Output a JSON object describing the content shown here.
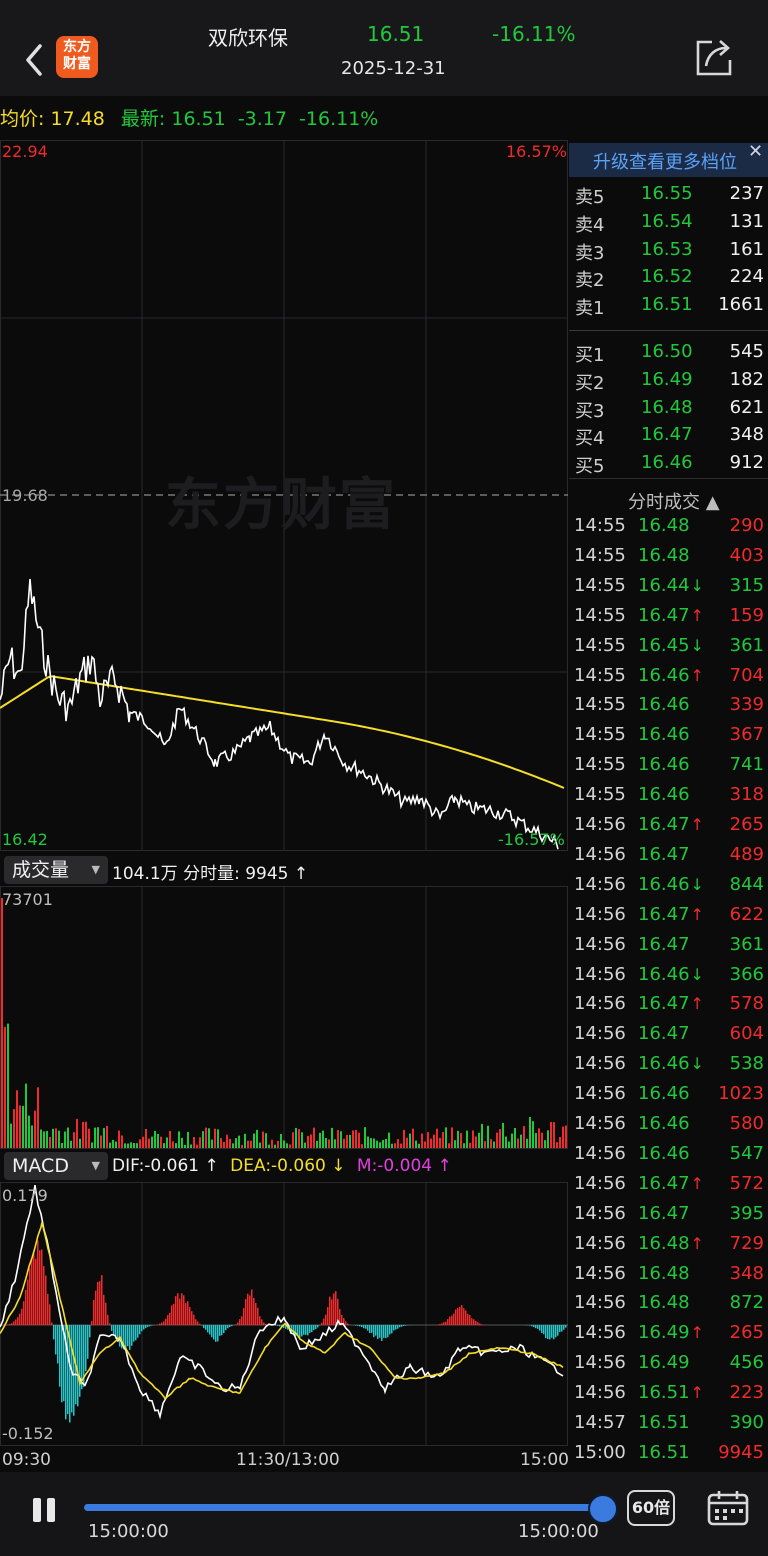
{
  "header": {
    "logo_line1": "东方",
    "logo_line2": "财富",
    "stock_name": "双欣环保",
    "price": "16.51",
    "pct": "-16.11%",
    "date": "2025-12-31"
  },
  "infobar": {
    "avg_label": "均价:",
    "avg_value": "17.48",
    "latest_label": "最新:",
    "latest_value": "16.51",
    "change": "-3.17",
    "pct": "-16.11%"
  },
  "price_chart": {
    "y_top": "22.94",
    "y_mid": "19.68",
    "y_bottom": "16.42",
    "pct_top": "16.57%",
    "pct_bottom": "-16.57%",
    "watermark": "东方财富"
  },
  "volume": {
    "selector": "成交量",
    "total": "104.1万",
    "tick_label": "分时量:",
    "tick_value": "9945",
    "tick_arrow": "↑",
    "max_label": "73701"
  },
  "macd": {
    "selector": "MACD",
    "dif": "DIF:-0.061 ↑",
    "dea": "DEA:-0.060 ↓",
    "m": "M:-0.004 ↑",
    "top": "0.179",
    "bottom": "-0.152"
  },
  "time_axis": {
    "start": "09:30",
    "mid": "11:30/13:00",
    "end": "15:00"
  },
  "orderbook": {
    "upgrade": "升级查看更多档位",
    "asks": [
      {
        "label": "卖5",
        "price": "16.55",
        "qty": "237"
      },
      {
        "label": "卖4",
        "price": "16.54",
        "qty": "131"
      },
      {
        "label": "卖3",
        "price": "16.53",
        "qty": "161"
      },
      {
        "label": "卖2",
        "price": "16.52",
        "qty": "224"
      },
      {
        "label": "卖1",
        "price": "16.51",
        "qty": "1661"
      }
    ],
    "bids": [
      {
        "label": "买1",
        "price": "16.50",
        "qty": "545"
      },
      {
        "label": "买2",
        "price": "16.49",
        "qty": "182"
      },
      {
        "label": "买3",
        "price": "16.48",
        "qty": "621"
      },
      {
        "label": "买4",
        "price": "16.47",
        "qty": "348"
      },
      {
        "label": "买5",
        "price": "16.46",
        "qty": "912"
      }
    ]
  },
  "ticks": {
    "title": "分时成交 ▲",
    "rows": [
      {
        "time": "14:55",
        "price": "16.48",
        "arrow": "",
        "vol": "290",
        "color": "#ef2b2b"
      },
      {
        "time": "14:55",
        "price": "16.48",
        "arrow": "",
        "vol": "403",
        "color": "#ef2b2b"
      },
      {
        "time": "14:55",
        "price": "16.44",
        "arrow": "↓",
        "vol": "315",
        "color": "#22c83c"
      },
      {
        "time": "14:55",
        "price": "16.47",
        "arrow": "↑",
        "vol": "159",
        "color": "#ef2b2b"
      },
      {
        "time": "14:55",
        "price": "16.45",
        "arrow": "↓",
        "vol": "361",
        "color": "#22c83c"
      },
      {
        "time": "14:55",
        "price": "16.46",
        "arrow": "↑",
        "vol": "704",
        "color": "#ef2b2b"
      },
      {
        "time": "14:55",
        "price": "16.46",
        "arrow": "",
        "vol": "339",
        "color": "#ef2b2b"
      },
      {
        "time": "14:55",
        "price": "16.46",
        "arrow": "",
        "vol": "367",
        "color": "#ef2b2b"
      },
      {
        "time": "14:55",
        "price": "16.46",
        "arrow": "",
        "vol": "741",
        "color": "#22c83c"
      },
      {
        "time": "14:55",
        "price": "16.46",
        "arrow": "",
        "vol": "318",
        "color": "#ef2b2b"
      },
      {
        "time": "14:56",
        "price": "16.47",
        "arrow": "↑",
        "vol": "265",
        "color": "#ef2b2b"
      },
      {
        "time": "14:56",
        "price": "16.47",
        "arrow": "",
        "vol": "489",
        "color": "#ef2b2b"
      },
      {
        "time": "14:56",
        "price": "16.46",
        "arrow": "↓",
        "vol": "844",
        "color": "#22c83c"
      },
      {
        "time": "14:56",
        "price": "16.47",
        "arrow": "↑",
        "vol": "622",
        "color": "#ef2b2b"
      },
      {
        "time": "14:56",
        "price": "16.47",
        "arrow": "",
        "vol": "361",
        "color": "#22c83c"
      },
      {
        "time": "14:56",
        "price": "16.46",
        "arrow": "↓",
        "vol": "366",
        "color": "#22c83c"
      },
      {
        "time": "14:56",
        "price": "16.47",
        "arrow": "↑",
        "vol": "578",
        "color": "#ef2b2b"
      },
      {
        "time": "14:56",
        "price": "16.47",
        "arrow": "",
        "vol": "604",
        "color": "#ef2b2b"
      },
      {
        "time": "14:56",
        "price": "16.46",
        "arrow": "↓",
        "vol": "538",
        "color": "#22c83c"
      },
      {
        "time": "14:56",
        "price": "16.46",
        "arrow": "",
        "vol": "1023",
        "color": "#ef2b2b"
      },
      {
        "time": "14:56",
        "price": "16.46",
        "arrow": "",
        "vol": "580",
        "color": "#ef2b2b"
      },
      {
        "time": "14:56",
        "price": "16.46",
        "arrow": "",
        "vol": "547",
        "color": "#22c83c"
      },
      {
        "time": "14:56",
        "price": "16.47",
        "arrow": "↑",
        "vol": "572",
        "color": "#ef2b2b"
      },
      {
        "time": "14:56",
        "price": "16.47",
        "arrow": "",
        "vol": "395",
        "color": "#22c83c"
      },
      {
        "time": "14:56",
        "price": "16.48",
        "arrow": "↑",
        "vol": "729",
        "color": "#ef2b2b"
      },
      {
        "time": "14:56",
        "price": "16.48",
        "arrow": "",
        "vol": "348",
        "color": "#ef2b2b"
      },
      {
        "time": "14:56",
        "price": "16.48",
        "arrow": "",
        "vol": "872",
        "color": "#22c83c"
      },
      {
        "time": "14:56",
        "price": "16.49",
        "arrow": "↑",
        "vol": "265",
        "color": "#ef2b2b"
      },
      {
        "time": "14:56",
        "price": "16.49",
        "arrow": "",
        "vol": "456",
        "color": "#22c83c"
      },
      {
        "time": "14:56",
        "price": "16.51",
        "arrow": "↑",
        "vol": "223",
        "color": "#ef2b2b"
      },
      {
        "time": "14:57",
        "price": "16.51",
        "arrow": "",
        "vol": "390",
        "color": "#22c83c"
      },
      {
        "time": "15:00",
        "price": "16.51",
        "arrow": "",
        "vol": "9945",
        "color": "#ef2b2b"
      }
    ]
  },
  "player": {
    "speed": "60倍",
    "start_time": "15:00:00",
    "end_time": "15:00:00",
    "progress": 1.0
  },
  "colors": {
    "up": "#ef2b2b",
    "down": "#22c83c",
    "avg_line": "#f5dd29",
    "price_line": "#ffffff",
    "macd_neg": "#2bc4c8",
    "accent": "#3b7be0"
  },
  "chart_data": {
    "type": "line",
    "x": [
      "09:30",
      "11:30/13:00",
      "15:00"
    ],
    "ylim": [
      16.42,
      22.94
    ],
    "prev_close": 19.68,
    "series": [],
    "volume_max": 73701,
    "macd_range": [
      -0.152,
      0.179
    ]
  }
}
